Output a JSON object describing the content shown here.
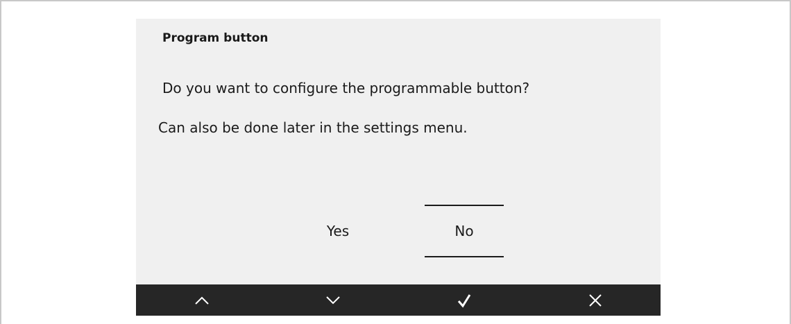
{
  "dialog": {
    "title": "Program button",
    "question": "Do you want to configure the programmable button?",
    "hint": "Can also be done later in the settings menu.",
    "options": [
      {
        "label": "Yes",
        "selected": false
      },
      {
        "label": "No",
        "selected": true
      }
    ]
  },
  "nav_bar": {
    "buttons": [
      {
        "icon": "chevron-up-icon"
      },
      {
        "icon": "chevron-down-icon"
      },
      {
        "icon": "checkmark-icon"
      },
      {
        "icon": "close-icon"
      }
    ]
  },
  "colors": {
    "screen_background": "#f0f0f0",
    "nav_bar_background": "#262626",
    "text": "#1a1a1a",
    "nav_icon": "#ffffff",
    "frame_border": "#c8c8c8"
  }
}
